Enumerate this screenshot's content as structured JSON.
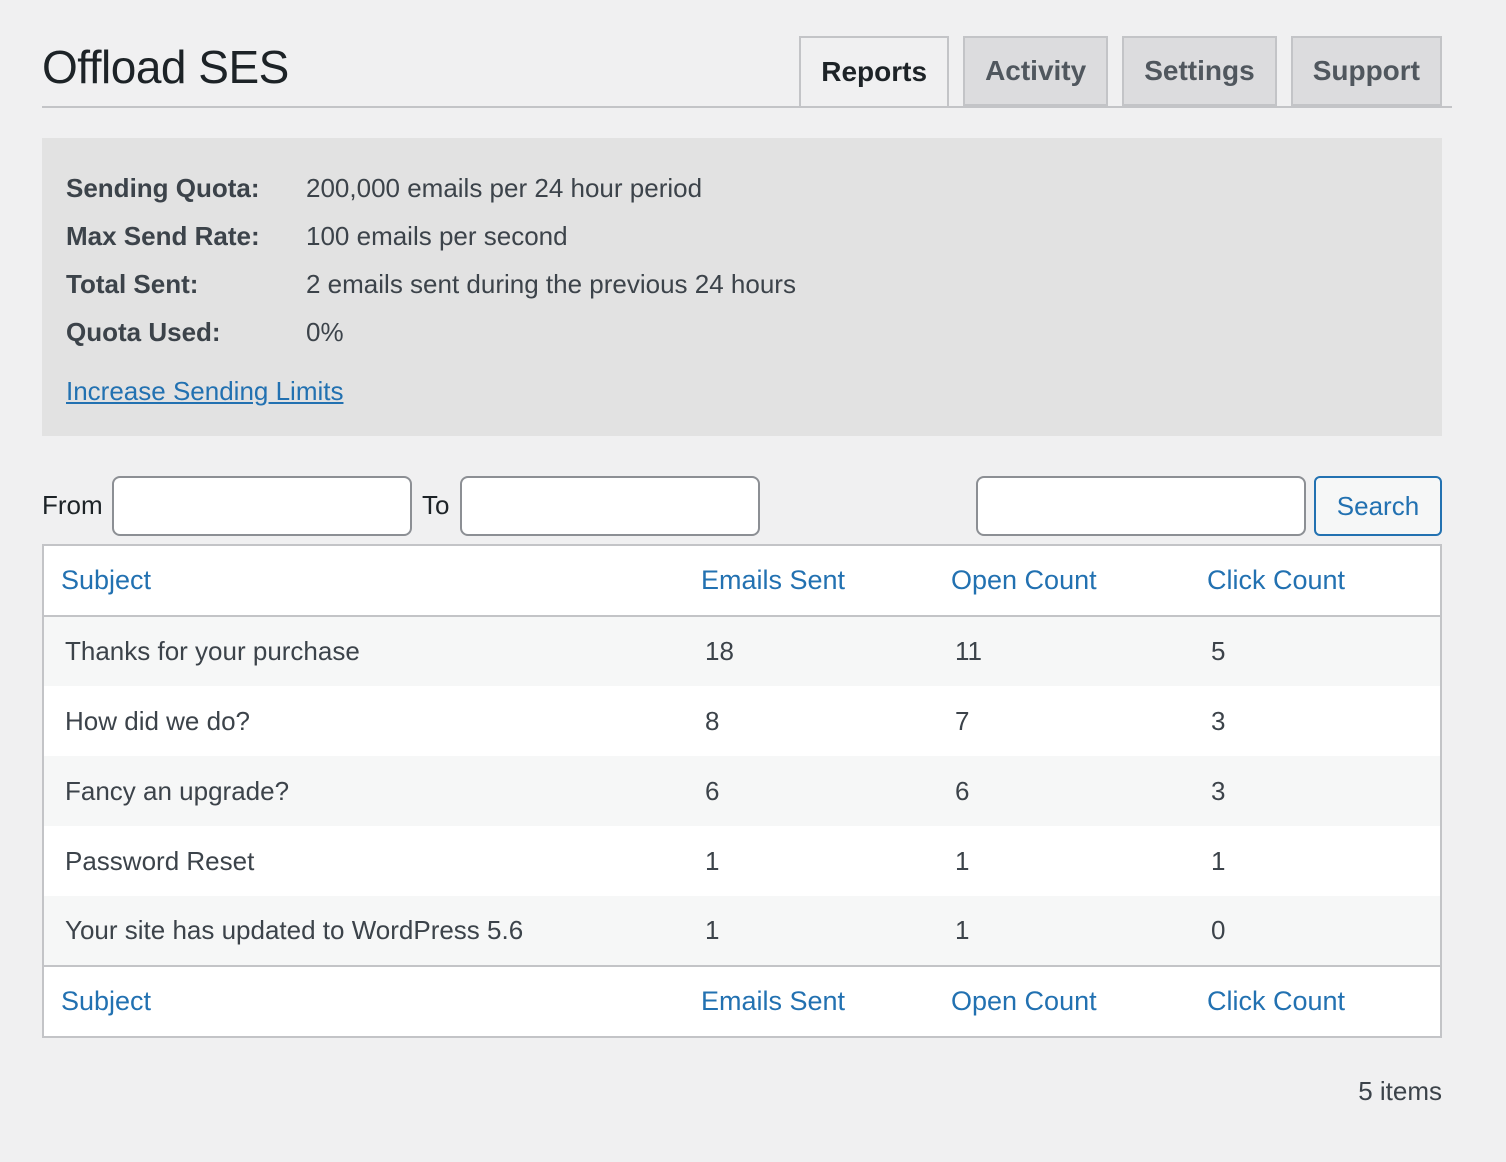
{
  "page": {
    "title": "Offload SES"
  },
  "tabs": [
    {
      "label": "Reports",
      "active": true
    },
    {
      "label": "Activity",
      "active": false
    },
    {
      "label": "Settings",
      "active": false
    },
    {
      "label": "Support",
      "active": false
    }
  ],
  "quota": {
    "rows": [
      {
        "label": "Sending Quota:",
        "value": "200,000 emails per 24 hour period"
      },
      {
        "label": "Max Send Rate:",
        "value": "100 emails per second"
      },
      {
        "label": "Total Sent:",
        "value": "2 emails sent during the previous 24 hours"
      },
      {
        "label": "Quota Used:",
        "value": "0%"
      }
    ],
    "link": "Increase Sending Limits"
  },
  "filters": {
    "from_label": "From",
    "from_value": "",
    "to_label": "To",
    "to_value": "",
    "search_value": "",
    "search_button": "Search"
  },
  "table": {
    "columns": [
      "Subject",
      "Emails Sent",
      "Open Count",
      "Click Count"
    ],
    "rows": [
      [
        "Thanks for your purchase",
        "18",
        "11",
        "5"
      ],
      [
        "How did we do?",
        "8",
        "7",
        "3"
      ],
      [
        "Fancy an upgrade?",
        "6",
        "6",
        "3"
      ],
      [
        "Password Reset",
        "1",
        "1",
        "1"
      ],
      [
        "Your site has updated to WordPress 5.6",
        "1",
        "1",
        "0"
      ]
    ]
  },
  "footer": {
    "items_count": "5 items"
  },
  "colors": {
    "link": "#2271b1",
    "text": "#3c434a",
    "background": "#f0f0f1"
  }
}
